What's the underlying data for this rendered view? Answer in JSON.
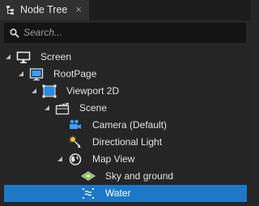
{
  "tab": {
    "label": "Node Tree",
    "icon": "node-tree-icon",
    "close_icon": "close-icon"
  },
  "search": {
    "placeholder": "Search...",
    "icon": "search-icon"
  },
  "tree": {
    "items": [
      {
        "label": "Screen",
        "icon": "monitor-icon",
        "expanded": true
      },
      {
        "label": "RootPage",
        "icon": "page-icon",
        "expanded": true
      },
      {
        "label": "Viewport 2D",
        "icon": "viewport-icon",
        "expanded": true
      },
      {
        "label": "Scene",
        "icon": "scene-icon",
        "expanded": true
      },
      {
        "label": "Camera (Default)",
        "icon": "camera-icon"
      },
      {
        "label": "Directional Light",
        "icon": "directional-light-icon"
      },
      {
        "label": "Map View",
        "icon": "map-view-icon",
        "expanded": true
      },
      {
        "label": "Sky and ground",
        "icon": "sky-ground-icon"
      },
      {
        "label": "Water",
        "icon": "water-icon",
        "selected": true
      }
    ]
  },
  "colors": {
    "selection": "#1e78c8",
    "accent_blue": "#3aa0ff",
    "background": "#252525"
  }
}
